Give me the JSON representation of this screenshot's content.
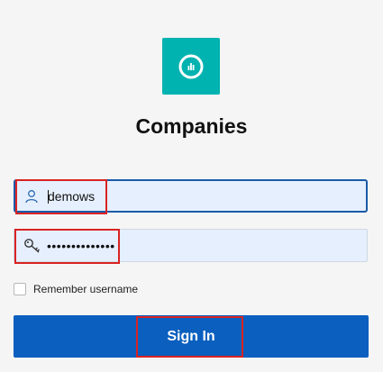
{
  "app": {
    "title": "Companies",
    "logo_icon": "chart-ring-icon",
    "brand_color": "#00b3b0"
  },
  "login": {
    "username": {
      "value": "demows",
      "icon": "user-icon"
    },
    "password": {
      "value": "••••••••••••••",
      "icon": "key-icon"
    },
    "remember": {
      "label": "Remember username",
      "checked": false
    },
    "submit_label": "Sign In",
    "button_color": "#0a5fbf",
    "highlight_color": "#d92323"
  }
}
